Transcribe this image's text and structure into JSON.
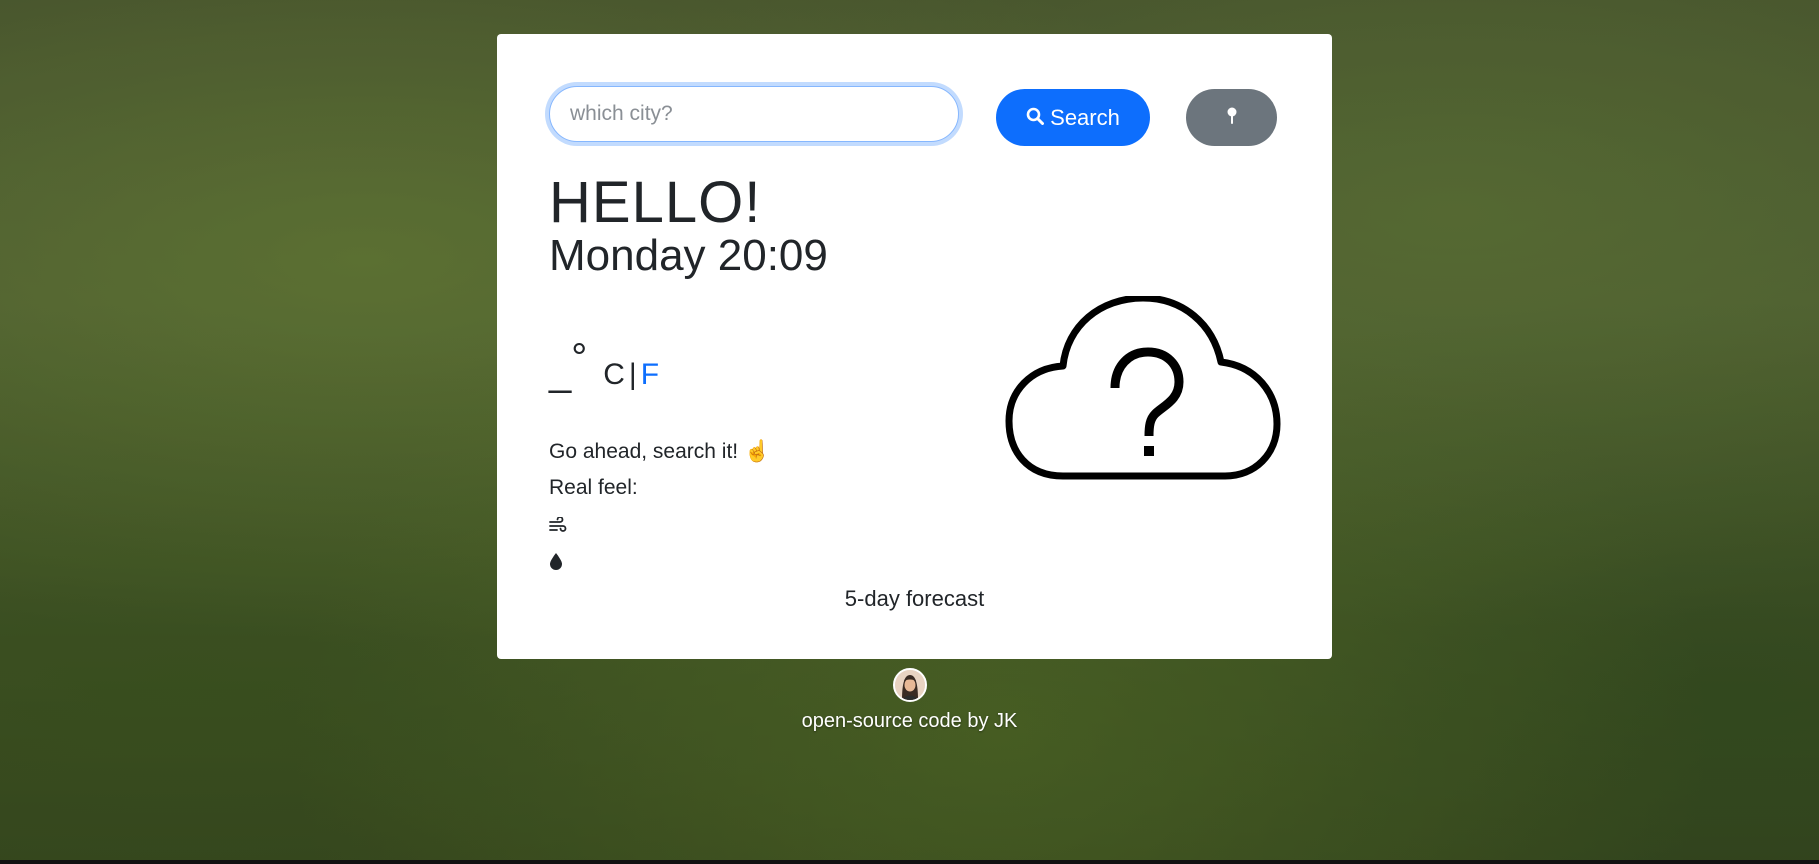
{
  "search": {
    "placeholder": "which city?",
    "value": "",
    "button_label": "Search"
  },
  "greeting": "HELLO!",
  "datetime": "Monday 20:09",
  "temperature": {
    "value": "_",
    "degree": "°",
    "unit_c": "C",
    "separator": "|",
    "unit_f": "F"
  },
  "description": {
    "line1": "Go ahead, search it! ☝️",
    "line2": "Real feel:"
  },
  "forecast_title": "5-day forecast",
  "footer": {
    "text": "open-source code by JK"
  },
  "icons": {
    "search": "search-icon",
    "location": "map-pin-icon",
    "wind": "wind-icon",
    "humidity": "droplet-icon",
    "weather": "cloud-question-icon"
  },
  "colors": {
    "primary": "#0d6efd",
    "secondary": "#6c757d",
    "card_bg": "#ffffff"
  }
}
